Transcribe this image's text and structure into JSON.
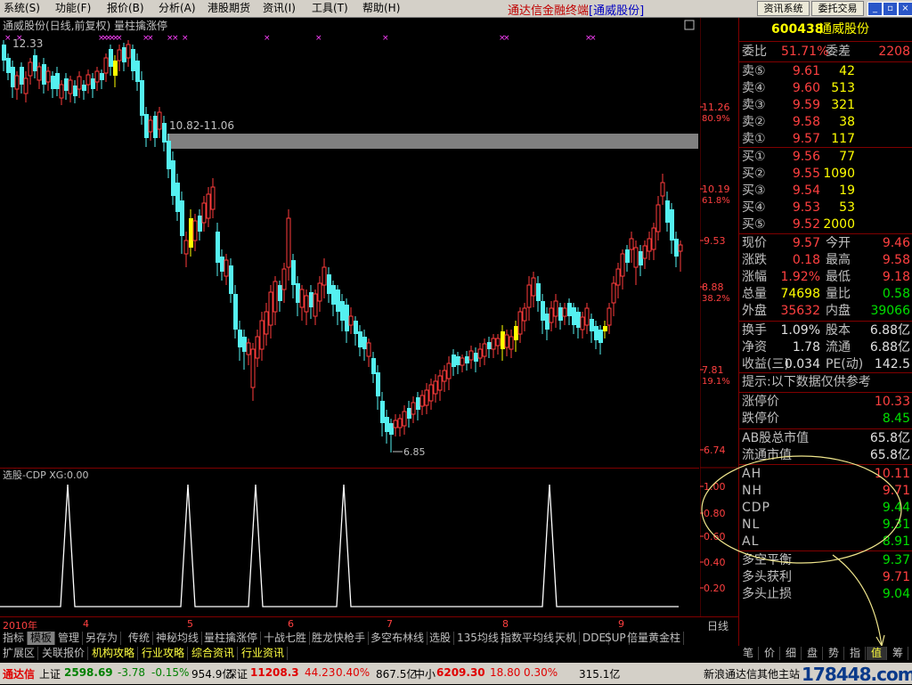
{
  "menu": [
    "系统(S)",
    "功能(F)",
    "报价(B)",
    "分析(A)",
    "港股期货",
    "资讯(I)",
    "工具(T)",
    "帮助(H)"
  ],
  "app_title": {
    "main": "通达信金融终端",
    "sub": "[通威股份]"
  },
  "top_buttons": [
    "资讯系统",
    "委托交易"
  ],
  "chart_title": "通威股份(日线,前复权) 量柱擒涨停",
  "price_labels": {
    "top_left": "12.33",
    "range": "10.82-11.06",
    "low_marker": "6.85"
  },
  "right_axis": [
    {
      "price": "11.26",
      "pct": "80.9%"
    },
    {
      "price": "10.19",
      "pct": "61.8%"
    },
    {
      "price": "9.53",
      "pct": ""
    },
    {
      "price": "8.88",
      "pct": "38.2%"
    },
    {
      "price": "7.81",
      "pct": "19.1%"
    },
    {
      "price": "6.74",
      "pct": ""
    }
  ],
  "indicator": {
    "title": "选股-CDP XG:0.00",
    "axis": [
      "1.00",
      "0.80",
      "0.60",
      "0.40",
      "0.20"
    ]
  },
  "time_axis": {
    "labels": [
      "2010年",
      "4",
      "5",
      "6",
      "7",
      "8",
      "9"
    ],
    "period": "日线"
  },
  "stock": {
    "code": "600438",
    "name": "通威股份"
  },
  "order_book": {
    "wei_bi_label": "委比",
    "wei_bi": "51.71%",
    "wei_cha_label": "委差",
    "wei_cha": "2208",
    "sell": [
      {
        "label": "卖⑤",
        "price": "9.61",
        "vol": "42"
      },
      {
        "label": "卖④",
        "price": "9.60",
        "vol": "513"
      },
      {
        "label": "卖③",
        "price": "9.59",
        "vol": "321"
      },
      {
        "label": "卖②",
        "price": "9.58",
        "vol": "38"
      },
      {
        "label": "卖①",
        "price": "9.57",
        "vol": "117"
      }
    ],
    "buy": [
      {
        "label": "买①",
        "price": "9.56",
        "vol": "77"
      },
      {
        "label": "买②",
        "price": "9.55",
        "vol": "1090"
      },
      {
        "label": "买③",
        "price": "9.54",
        "vol": "19"
      },
      {
        "label": "买④",
        "price": "9.53",
        "vol": "53"
      },
      {
        "label": "买⑤",
        "price": "9.52",
        "vol": "2000"
      }
    ]
  },
  "quote": [
    {
      "l1": "现价",
      "v1": "9.57",
      "c1": "red",
      "l2": "今开",
      "v2": "9.46",
      "c2": "red"
    },
    {
      "l1": "涨跌",
      "v1": "0.18",
      "c1": "red",
      "l2": "最高",
      "v2": "9.58",
      "c2": "red"
    },
    {
      "l1": "涨幅",
      "v1": "1.92%",
      "c1": "red",
      "l2": "最低",
      "v2": "9.18",
      "c2": "red"
    },
    {
      "l1": "总量",
      "v1": "74698",
      "c1": "yel",
      "l2": "量比",
      "v2": "0.58",
      "c2": "grn"
    },
    {
      "l1": "外盘",
      "v1": "35632",
      "c1": "red",
      "l2": "内盘",
      "v2": "39066",
      "c2": "grn"
    }
  ],
  "fundamentals": [
    {
      "l1": "换手",
      "v1": "1.09%",
      "l2": "股本",
      "v2": "6.88亿"
    },
    {
      "l1": "净资",
      "v1": "1.78",
      "l2": "流通",
      "v2": "6.88亿"
    },
    {
      "l1": "收益(三)",
      "v1": "0.034",
      "l2": "PE(动)",
      "v2": "142.5"
    }
  ],
  "notice": "提示:以下数据仅供参考",
  "limits": [
    {
      "label": "涨停价",
      "value": "10.33",
      "color": "red"
    },
    {
      "label": "跌停价",
      "value": "8.45",
      "color": "grn"
    }
  ],
  "market_value": [
    {
      "label": "AB股总市值",
      "value": "65.8亿"
    },
    {
      "label": "流通市值",
      "value": "65.8亿"
    }
  ],
  "cdp": [
    {
      "label": "AH",
      "value": "10.11",
      "color": "red"
    },
    {
      "label": "NH",
      "value": "9.71",
      "color": "red"
    },
    {
      "label": "CDP",
      "value": "9.44",
      "color": "grn"
    },
    {
      "label": "NL",
      "value": "9.31",
      "color": "grn"
    },
    {
      "label": "AL",
      "value": "8.91",
      "color": "grn"
    }
  ],
  "balance": [
    {
      "label": "多空平衡",
      "value": "9.37",
      "color": "grn"
    },
    {
      "label": "多头获利",
      "value": "9.71",
      "color": "red"
    },
    {
      "label": "多头止损",
      "value": "9.04",
      "color": "grn"
    }
  ],
  "tabs1": [
    "指标",
    "模板",
    "管理",
    "另存为",
    "传统",
    "神秘均线",
    "量柱擒涨停",
    "十战七胜",
    "胜龙快枪手",
    "多空布林线",
    "选股",
    "135均线",
    "指数平均线",
    "天机",
    "DDE",
    "SUP",
    "倍量黄金柱"
  ],
  "tabs2": [
    "扩展区",
    "关联报价",
    "机构攻略",
    "行业攻略",
    "综合资讯",
    "行业资讯"
  ],
  "right_tabs": [
    "笔",
    "价",
    "细",
    "盘",
    "势",
    "指",
    "值",
    "筹"
  ],
  "status": {
    "brand": "通达信",
    "sh_label": "上证",
    "sh_val": "2598.69",
    "sh_chg": "-3.78",
    "sh_pct": "-0.15%",
    "sh_amt": "954.9亿",
    "sz_label": "深证",
    "sz_val": "11208.3",
    "sz_chg": "44.23",
    "sz_pct": "0.40%",
    "sz_amt": "867.5亿",
    "zx_label": "中小",
    "zx_val": "6209.30",
    "zx_chg": "18.80",
    "zx_pct": "0.30%",
    "zx_amt": "315.1亿",
    "site": "新浪通达信其他主站",
    "watermark": "178448.com"
  }
}
